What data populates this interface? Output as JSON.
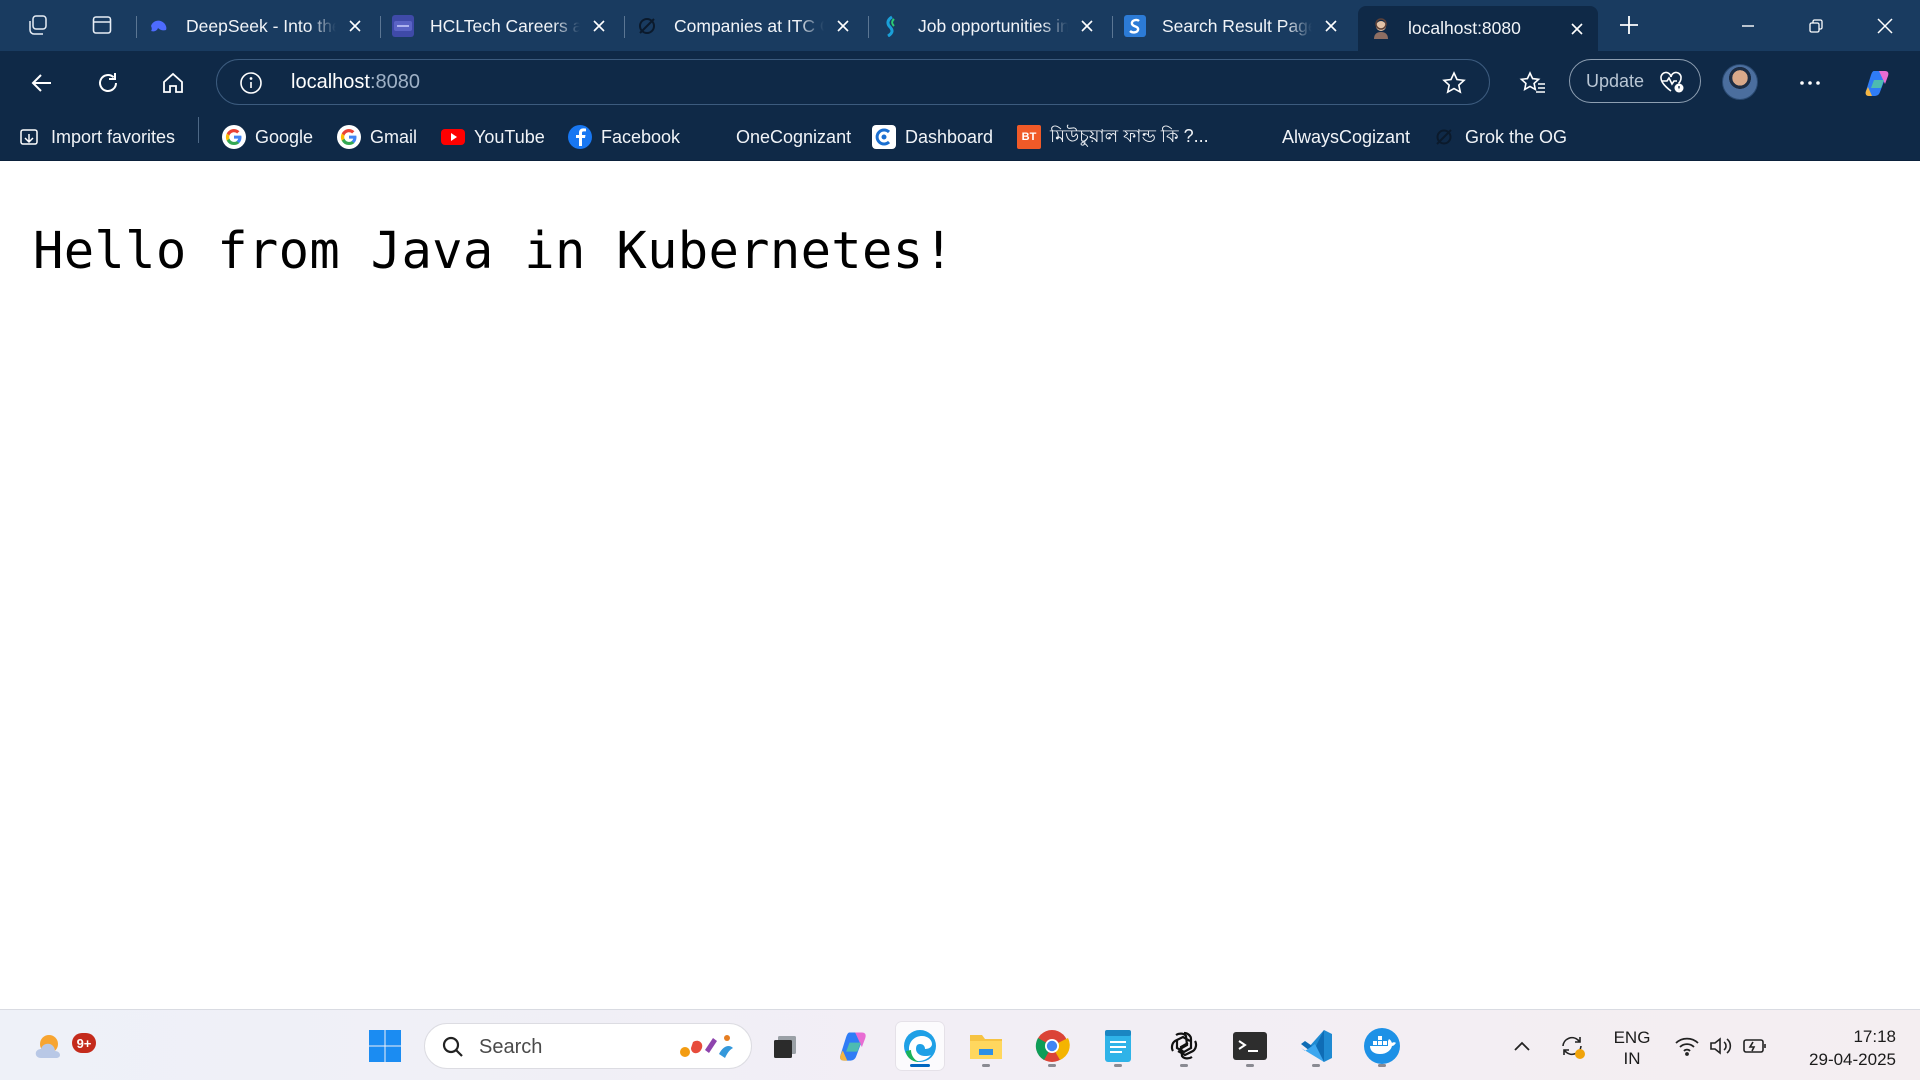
{
  "browser": {
    "tabs": [
      {
        "title": "DeepSeek - Into the Unknown",
        "favicon": "deepseek-icon"
      },
      {
        "title": "HCLTech Careers and Jobs",
        "favicon": "hcltech-icon"
      },
      {
        "title": "Companies at ITC Grid",
        "favicon": "grok-icon"
      },
      {
        "title": "Job opportunities in",
        "favicon": "jobs-icon"
      },
      {
        "title": "Search Result Page",
        "favicon": "search-result-icon"
      },
      {
        "title": "localhost:8080",
        "favicon": "localhost-icon",
        "active": true
      }
    ],
    "address": {
      "host": "localhost",
      "port": ":8080"
    },
    "update_label": "Update",
    "favorites": [
      {
        "label": "Import favorites",
        "icon": "import-icon"
      },
      {
        "label": "Google",
        "icon": "google-icon"
      },
      {
        "label": "Gmail",
        "icon": "google-icon"
      },
      {
        "label": "YouTube",
        "icon": "youtube-icon"
      },
      {
        "label": "Facebook",
        "icon": "facebook-icon"
      },
      {
        "label": "OneCognizant",
        "icon": "cognizant-icon"
      },
      {
        "label": "Dashboard",
        "icon": "dashboard-icon"
      },
      {
        "label": "মিউচুয়াল ফান্ড কি ?...",
        "icon": "bt-icon",
        "icon_text": "BT"
      },
      {
        "label": "AlwaysCogizant",
        "icon": "cognizant-icon"
      },
      {
        "label": "Grok the OG",
        "icon": "grok-icon"
      }
    ]
  },
  "page": {
    "heading": "Hello from Java in Kubernetes!"
  },
  "taskbar": {
    "weather_badge": "9+",
    "search_placeholder": "Search",
    "language": {
      "line1": "ENG",
      "line2": "IN"
    },
    "clock": {
      "time": "17:18",
      "date": "29-04-2025"
    }
  },
  "colors": {
    "tabstrip_bg": "#193b60",
    "toolbar_bg": "#0f2947",
    "accent": "#0067c0"
  }
}
